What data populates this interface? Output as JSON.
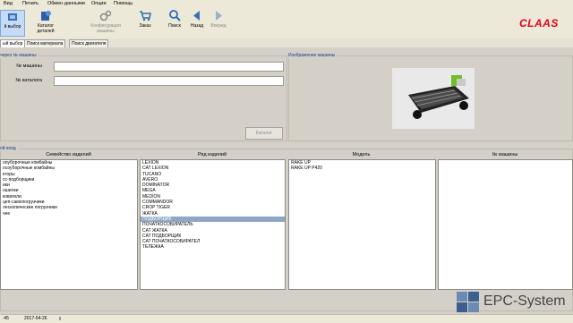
{
  "menu": [
    "Вид",
    "Печать",
    "Обмен данными",
    "Опции",
    "Помощь"
  ],
  "toolbar": {
    "buttons": [
      {
        "label": "й выбор",
        "icon": "home-icon"
      },
      {
        "label": "Каталог деталей",
        "icon": "catalog-icon"
      },
      {
        "label": "Конфигурация машины",
        "icon": "gears-icon"
      },
      {
        "label": "Заказ",
        "icon": "cart-icon"
      },
      {
        "label": "Поиск",
        "icon": "search-icon"
      },
      {
        "label": "Назад",
        "icon": "back-icon"
      },
      {
        "label": "Вперед",
        "icon": "forward-icon"
      }
    ],
    "brand": "CLAAS",
    "brand_color": "#e2001a"
  },
  "tabs": [
    "ый выбор",
    "Поиск материала",
    "Поиск двигателя"
  ],
  "search_panel": {
    "legend": "через № машины",
    "machine_label": "№ машины",
    "catalog_label": "№ каталога",
    "catalog_button": "Каталог"
  },
  "image_panel": {
    "legend": "Изображение машины"
  },
  "entry_panel": {
    "legend": "ой вход",
    "columns": [
      "Семейство изделий",
      "Ряд изделий",
      "Модель",
      "№ машины"
    ],
    "families": [
      "ноуборочные комбайны",
      "осоуборочные комбайны",
      "кторы",
      "сс-подборщики",
      "ики",
      "ошилки",
      "кователи",
      "цеп-самопогрузчики",
      "лескопические погрузчики",
      "чее"
    ],
    "series": [
      "LEXION",
      "CAT LEXION",
      "TUCANO",
      "AVERO",
      "DOMINATOR",
      "MEGA",
      "MEDION",
      "COMMANDOR",
      "CROP TIGER",
      "ЖАТКА",
      "ПОДБОРЩИК",
      "ПОЧАТКОСОБИРАТЕЛЬ",
      "CAT ЖАТКА",
      "CAT ПОДБОРЩИК",
      "CAT ПОЧАТКОСОБИРАТЕЛ",
      "ТЕЛЕЖКА"
    ],
    "selected_series_index": 10,
    "models": [
      "RAKE UP",
      "RAKE UP  P420"
    ],
    "machine_numbers": []
  },
  "status": {
    "time": ":45",
    "date": "2017-04-26"
  },
  "watermark": "EPC-System"
}
